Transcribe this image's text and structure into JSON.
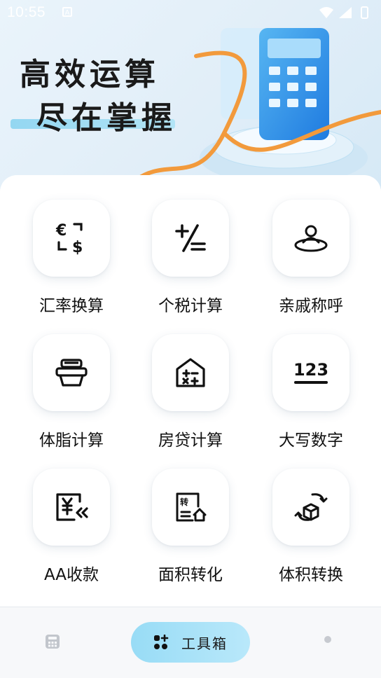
{
  "status_bar": {
    "time": "10:55",
    "indicator": "A"
  },
  "hero": {
    "slogan_line1": "高效运算",
    "slogan_line2": "尽在掌握"
  },
  "tools": [
    {
      "label": "汇率换算",
      "icon": "currency-exchange-icon"
    },
    {
      "label": "个税计算",
      "icon": "plus-minus-icon"
    },
    {
      "label": "亲戚称呼",
      "icon": "relatives-icon"
    },
    {
      "label": "体脂计算",
      "icon": "body-scale-icon"
    },
    {
      "label": "房贷计算",
      "icon": "house-calculator-icon"
    },
    {
      "label": "大写数字",
      "icon": "number-123-icon"
    },
    {
      "label": "AA收款",
      "icon": "yuan-receipt-icon"
    },
    {
      "label": "面积转化",
      "icon": "area-convert-icon"
    },
    {
      "label": "体积转换",
      "icon": "volume-convert-icon"
    }
  ],
  "bottom_nav": {
    "active_label": "工具箱",
    "items": [
      {
        "icon": "calculator-icon"
      },
      {
        "icon": "toolbox-icon"
      },
      {
        "icon": "dot-icon"
      }
    ]
  },
  "colors": {
    "accent": "#98dcf6",
    "text": "#111111"
  }
}
